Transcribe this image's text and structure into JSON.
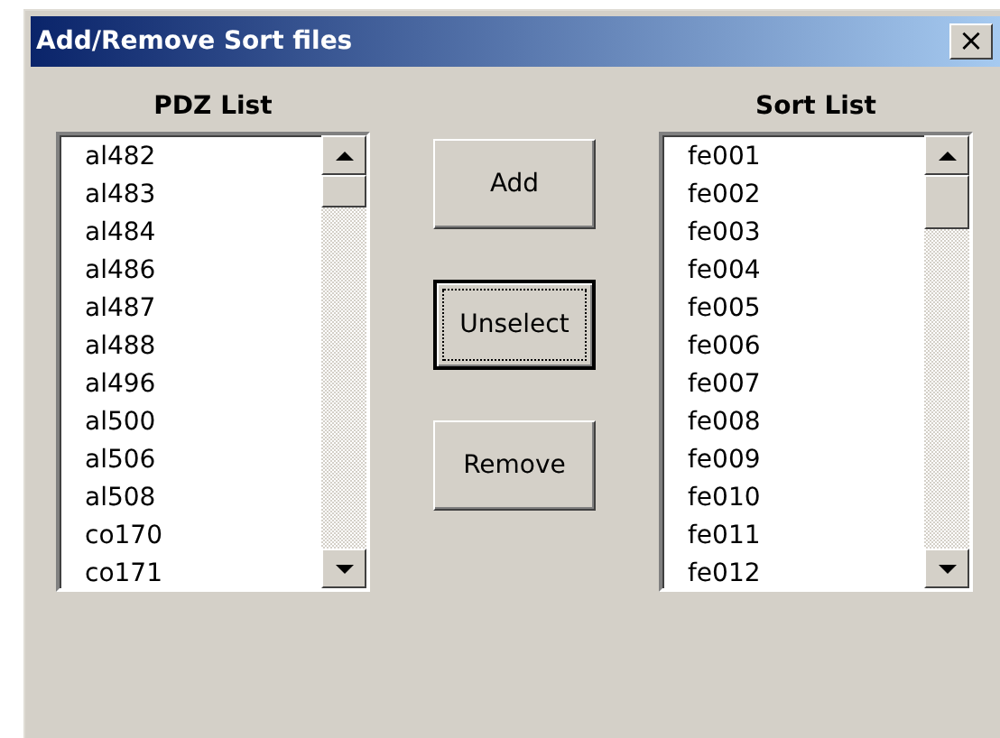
{
  "window": {
    "title": "Add/Remove Sort files",
    "close": "×"
  },
  "pdz_list": {
    "heading": "PDZ List",
    "items": [
      "al482",
      "al483",
      "al484",
      "al486",
      "al487",
      "al488",
      "al496",
      "al500",
      "al506",
      "al508",
      "co170",
      "co171"
    ]
  },
  "buttons": [
    {
      "label": "Add",
      "focused": false
    },
    {
      "label": "Unselect",
      "focused": true
    },
    {
      "label": "Remove",
      "focused": false
    }
  ],
  "sort_list": {
    "heading": "Sort List",
    "items": [
      "fe001",
      "fe002",
      "fe003",
      "fe004",
      "fe005",
      "fe006",
      "fe007",
      "fe008",
      "fe009",
      "fe010",
      "fe011",
      "fe012"
    ]
  }
}
